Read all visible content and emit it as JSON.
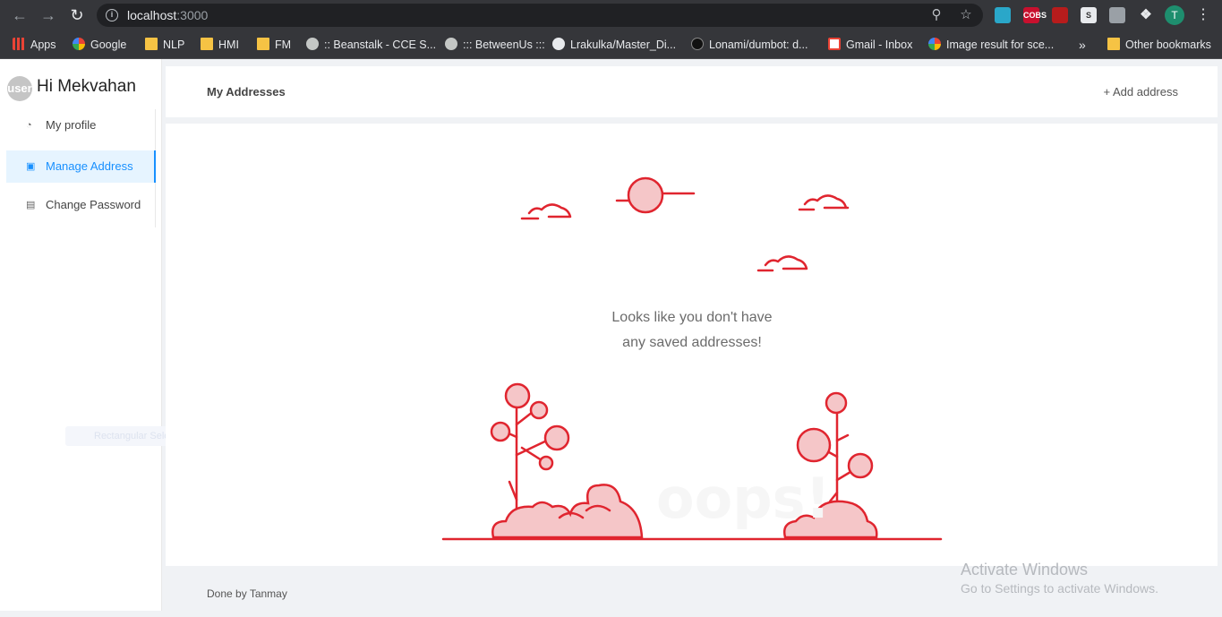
{
  "browser": {
    "url_host": "localhost",
    "url_port": ":3000",
    "bookmarks": [
      {
        "label": "Apps",
        "icon": "apps-grid-icon"
      },
      {
        "label": "Google",
        "icon": "google-icon"
      },
      {
        "label": "NLP",
        "icon": "folder-icon"
      },
      {
        "label": "HMI",
        "icon": "folder-icon"
      },
      {
        "label": "FM",
        "icon": "folder-icon"
      },
      {
        "label": ":: Beanstalk - CCE S...",
        "icon": "globe-icon"
      },
      {
        "label": "::: BetweenUs :::",
        "icon": "globe-icon"
      },
      {
        "label": "Lrakulka/Master_Di...",
        "icon": "github-icon"
      },
      {
        "label": "Lonami/dumbot: d...",
        "icon": "github-icon"
      },
      {
        "label": "Gmail - Inbox",
        "icon": "gmail-icon"
      },
      {
        "label": "Image result for sce...",
        "icon": "google-icon"
      }
    ],
    "more_bookmarks": "»",
    "other_bookmarks": "Other bookmarks",
    "profile_initial": "T",
    "extensions": [
      "cobs-extension-icon"
    ],
    "cobs_label": "COBS",
    "s_label": "S"
  },
  "sidebar": {
    "avatar_text": "user",
    "greeting": "Hi Mekvahan",
    "items": [
      {
        "label": "My profile",
        "icon": "pie-chart-icon"
      },
      {
        "label": "Manage Address",
        "icon": "desktop-icon",
        "selected": true
      },
      {
        "label": "Change Password",
        "icon": "lock-document-icon"
      }
    ],
    "ghost_label": "Rectangular Sele"
  },
  "header": {
    "title": "My Addresses",
    "add_label": "+ Add address"
  },
  "empty_state": {
    "line1": "Looks like you don't have",
    "line2": "any saved addresses!",
    "watermark_word": "oops!"
  },
  "footer": {
    "text": "Done by Tanmay"
  },
  "windows_watermark": {
    "title": "Activate Windows",
    "subtitle": "Go to Settings to activate Windows."
  },
  "colors": {
    "accent": "#1890ff",
    "illustration_red": "#e0252f",
    "illustration_fill": "#f5c6c8"
  }
}
